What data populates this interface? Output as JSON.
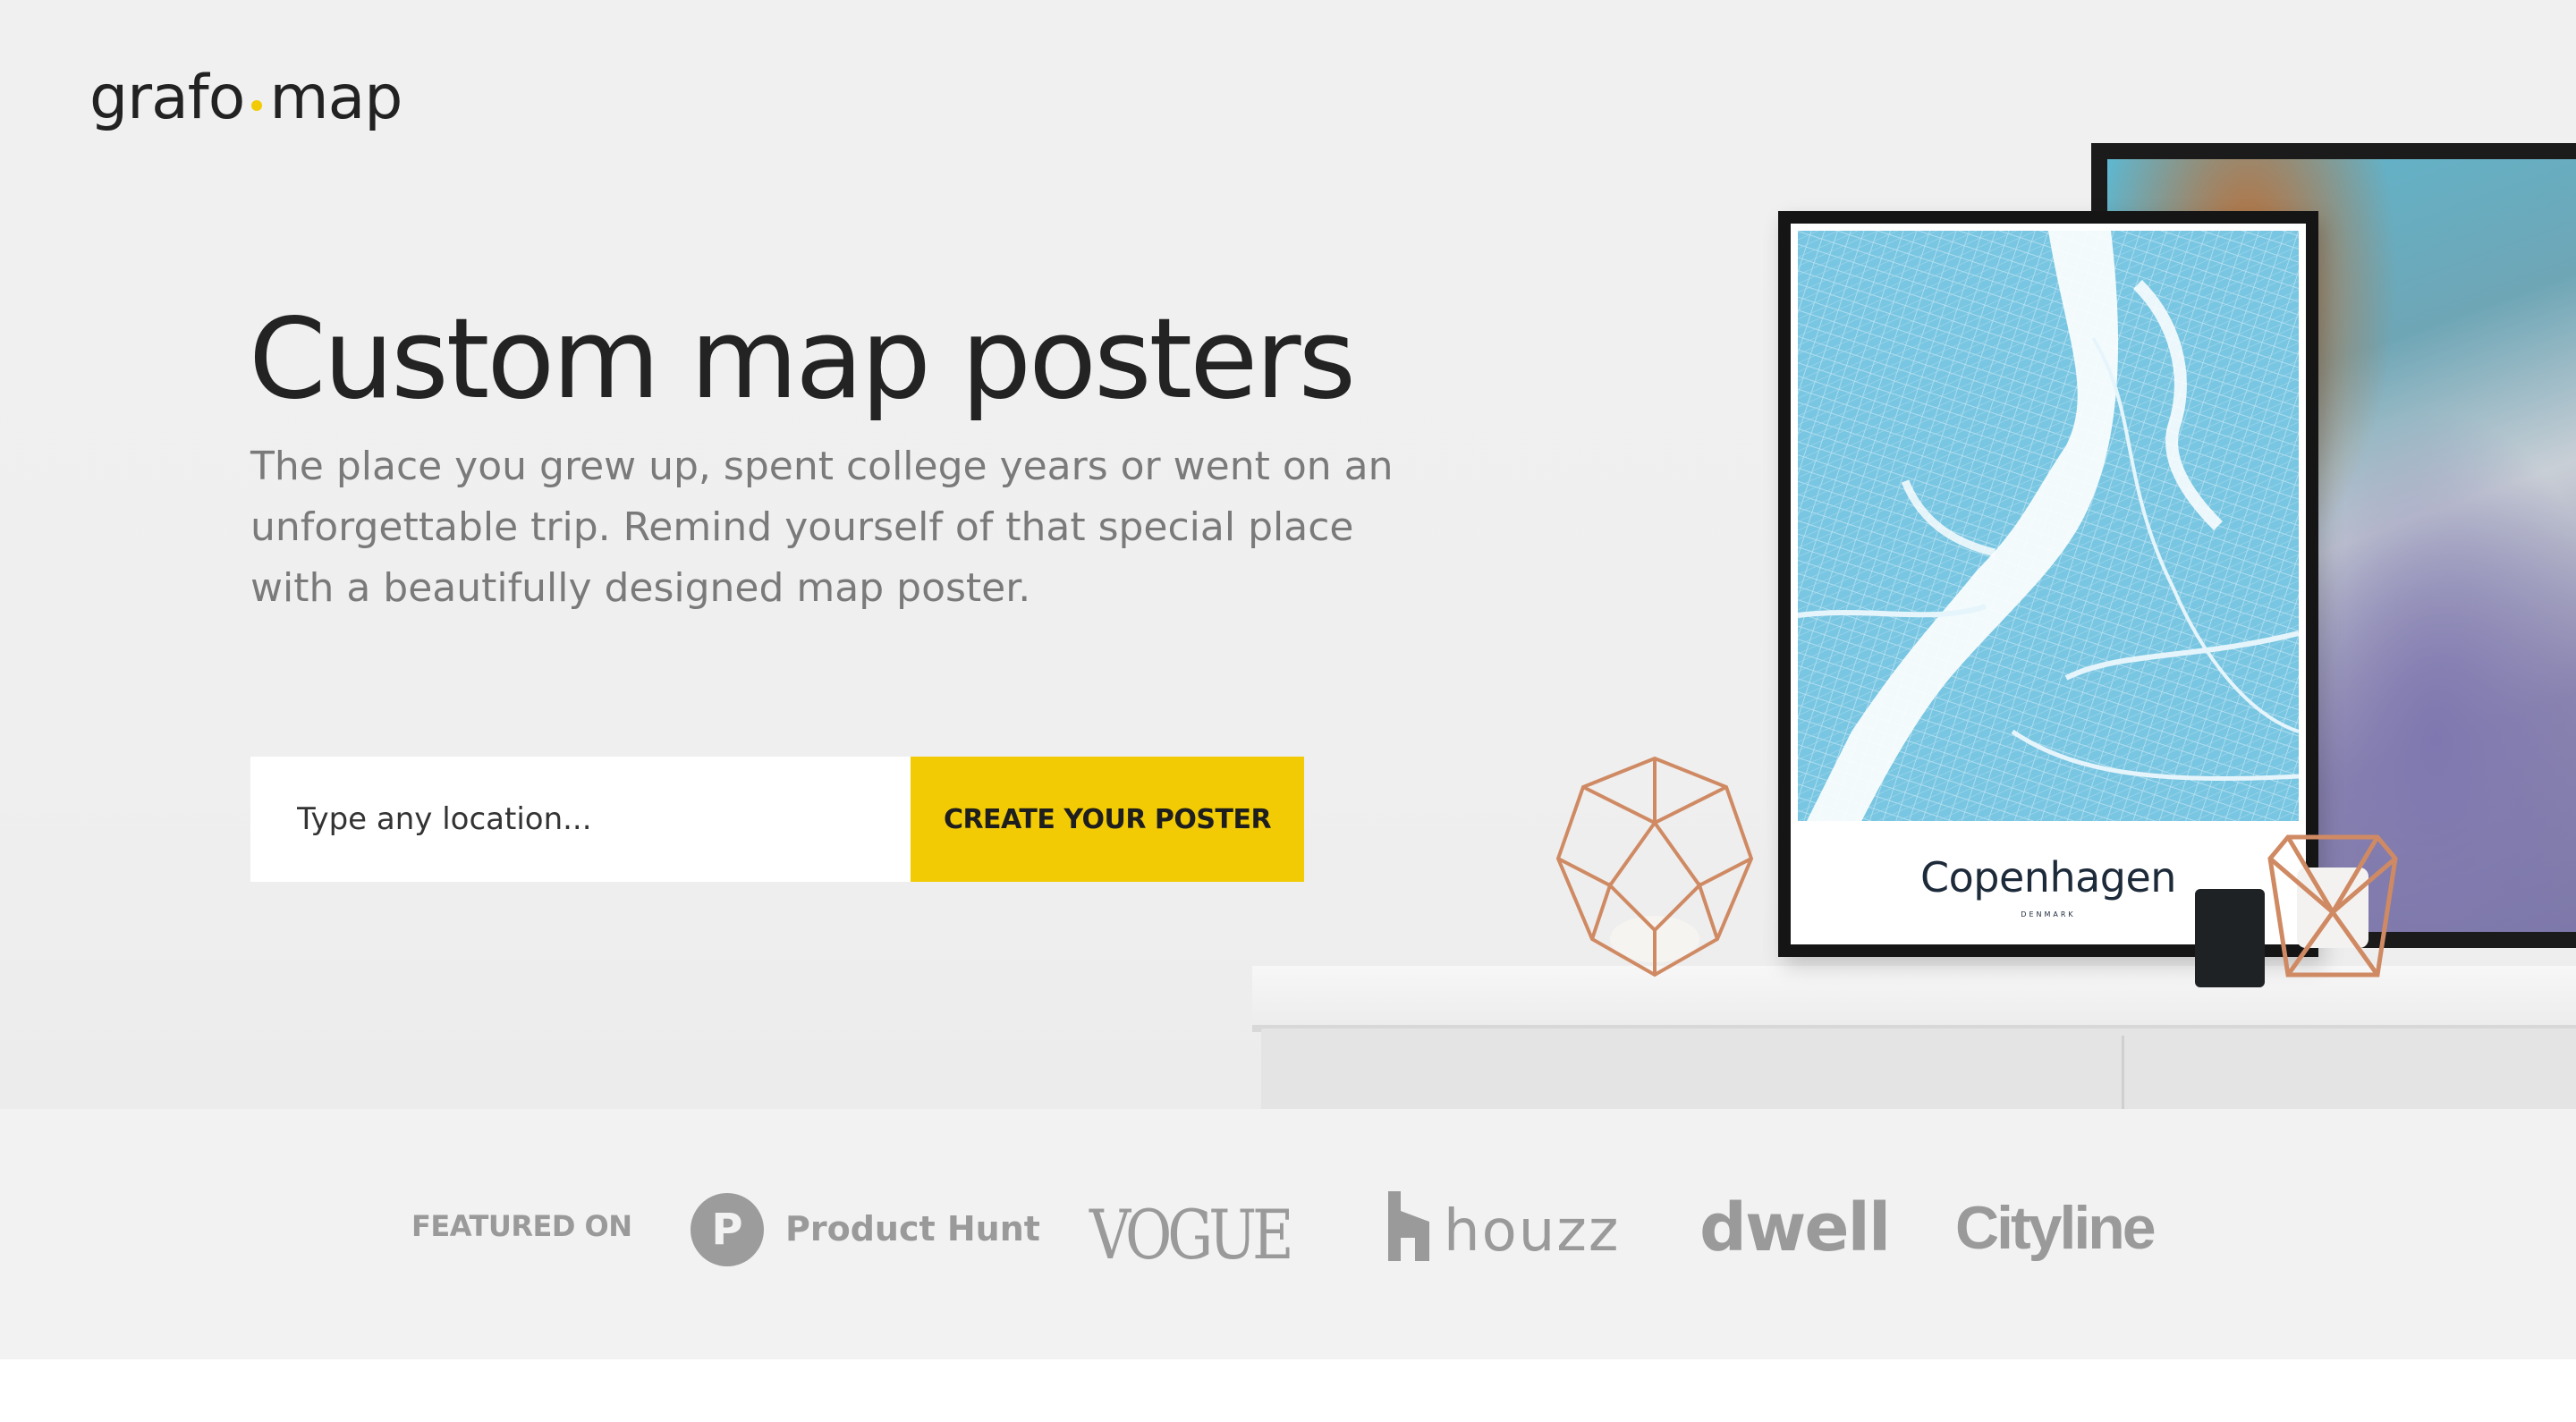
{
  "brand": {
    "logo_left": "grafo",
    "logo_right": "map",
    "accent_color": "#f2cb05"
  },
  "hero": {
    "title": "Custom map posters",
    "subtitle": "The place you grew up, spent college years or went on an unforgettable trip. Remind yourself of that special place with a beautifully designed map poster."
  },
  "search": {
    "placeholder": "Type any location...",
    "button_label": "CREATE YOUR POSTER"
  },
  "poster": {
    "city": "Copenhagen",
    "country": "DENMARK"
  },
  "featured": {
    "label": "FEATURED ON",
    "logos": [
      {
        "name": "Product Hunt",
        "badge": "P"
      },
      {
        "name": "VOGUE"
      },
      {
        "name": "houzz"
      },
      {
        "name": "dwell"
      },
      {
        "name": "Cityline"
      }
    ]
  }
}
